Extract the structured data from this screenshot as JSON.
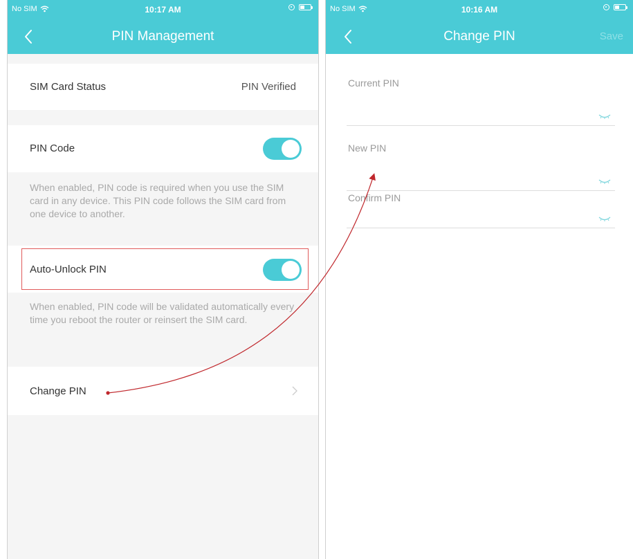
{
  "left_screen": {
    "status": {
      "carrier": "No SIM",
      "time": "10:17 AM"
    },
    "title": "PIN Management",
    "sim_status": {
      "label": "SIM Card Status",
      "value": "PIN Verified"
    },
    "pin_code": {
      "label": "PIN Code",
      "enabled": true,
      "description": "When enabled, PIN code is required when you use the SIM card in any device. This PIN code follows the SIM card from one device to another."
    },
    "auto_unlock": {
      "label": "Auto-Unlock PIN",
      "enabled": true,
      "description": "When enabled, PIN code will be validated automatically every time you reboot the router or reinsert the SIM card."
    },
    "change_pin": {
      "label": "Change PIN"
    }
  },
  "right_screen": {
    "status": {
      "carrier": "No SIM",
      "time": "10:16 AM"
    },
    "title": "Change PIN",
    "save_label": "Save",
    "fields": [
      {
        "label": "Current PIN",
        "value": ""
      },
      {
        "label": "New PIN",
        "value": ""
      },
      {
        "label": "Confirm PIN",
        "value": ""
      }
    ]
  },
  "colors": {
    "accent": "#4acbd6",
    "annotation": "#c0282d",
    "highlight_border": "#e05a5a"
  },
  "icons": [
    "wifi-icon",
    "lock-rotation-icon",
    "battery-icon",
    "back-chevron-icon",
    "chevron-right-icon",
    "eye-closed-icon"
  ]
}
